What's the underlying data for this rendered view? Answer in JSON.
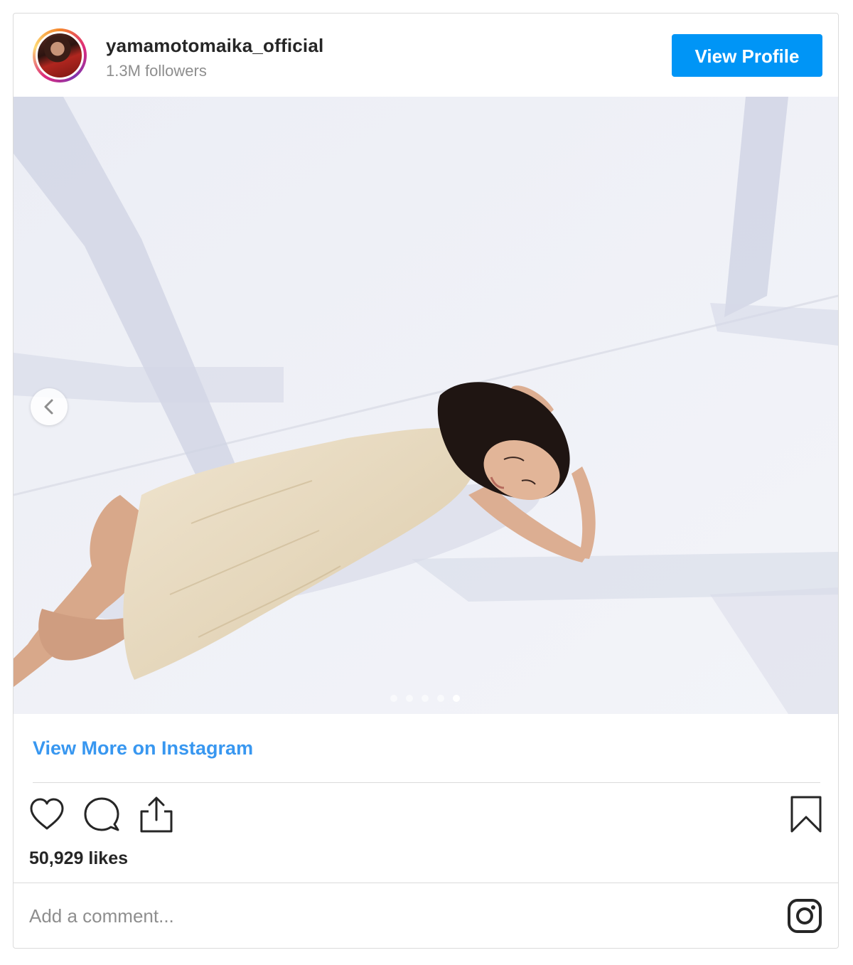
{
  "header": {
    "username": "yamamotomaika_official",
    "followers": "1.3M followers",
    "view_profile_label": "View Profile"
  },
  "post": {
    "carousel_total": 5,
    "carousel_active_index": 4
  },
  "links": {
    "view_more": "View More on Instagram"
  },
  "actions": {
    "icons": [
      "heart-icon",
      "comment-icon",
      "share-icon",
      "bookmark-icon"
    ]
  },
  "likes": "50,929 likes",
  "comment": {
    "placeholder": "Add a comment..."
  },
  "colors": {
    "accent": "#0095f6",
    "link": "#3897f0",
    "border": "#dbdbdb",
    "muted_text": "#8e8e8e"
  }
}
